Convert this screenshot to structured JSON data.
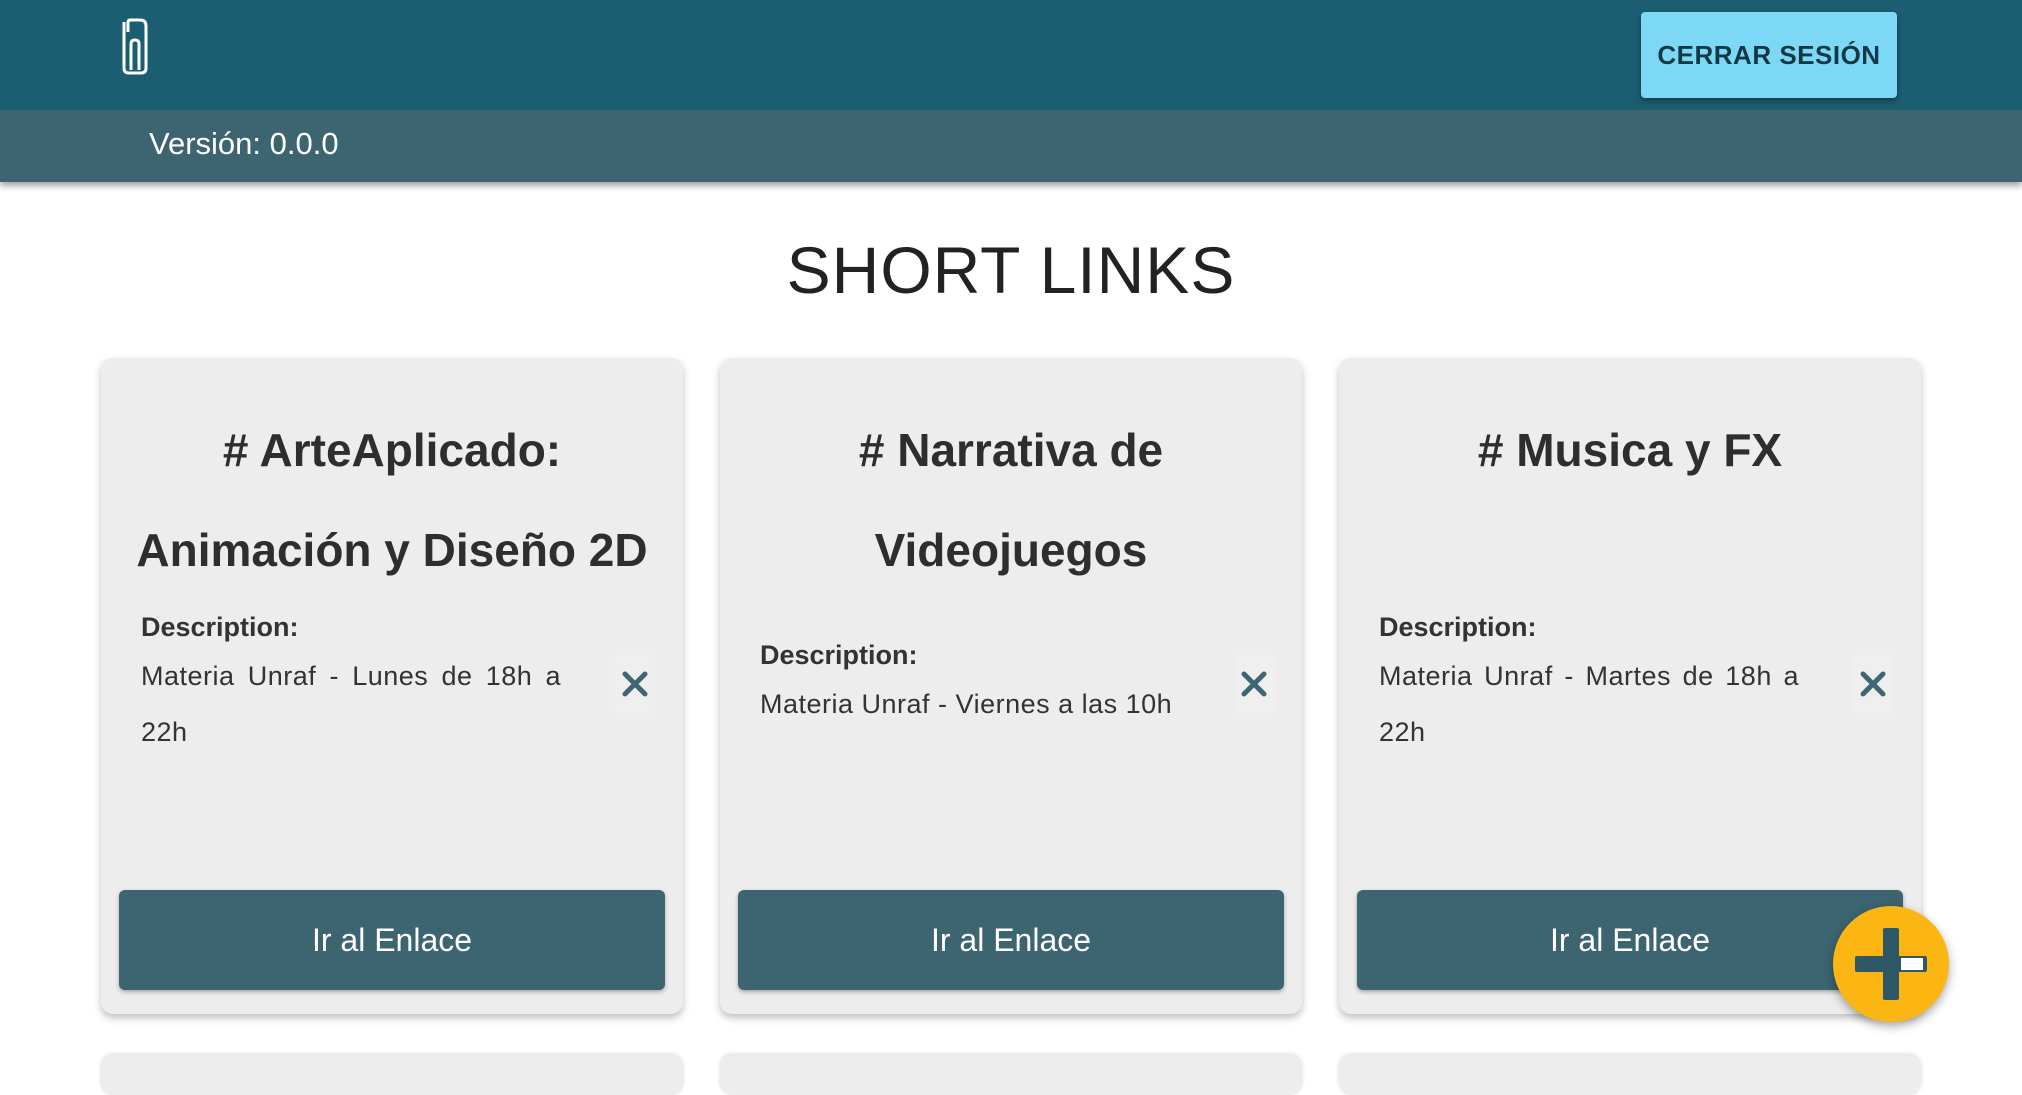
{
  "header": {
    "logo_icon": "paperclip-icon",
    "logout_label": "CERRAR SESIÓN",
    "version_text": "Versión: 0.0.0"
  },
  "page": {
    "title": "SHORT LINKS"
  },
  "cards": [
    {
      "title_line1": "# ArteAplicado:",
      "title_line2": "Animación y Diseño 2D",
      "description_label": "Description:",
      "description": "Materia Unraf - Lunes de 18h a 22h",
      "button_label": "Ir al Enlace",
      "delete_icon": "close-icon"
    },
    {
      "title_line1": "# Narrativa de",
      "title_line2": "Videojuegos",
      "description_label": "Description:",
      "description": "Materia Unraf - Viernes a las 10h",
      "button_label": "Ir al Enlace",
      "delete_icon": "close-icon"
    },
    {
      "title_line1": "# Musica y FX",
      "title_line2": "",
      "description_label": "Description:",
      "description": "Materia Unraf - Martes de 18h a 22h",
      "button_label": "Ir al Enlace",
      "delete_icon": "close-icon"
    }
  ],
  "fab": {
    "icon": "plus-icon"
  },
  "colors": {
    "topbar": "#1b5e71",
    "subbar": "#3c6471",
    "logout_button": "#7dd8f5",
    "card_bg": "#ededed",
    "card_button": "#3c6471",
    "fab": "#fbb614"
  }
}
